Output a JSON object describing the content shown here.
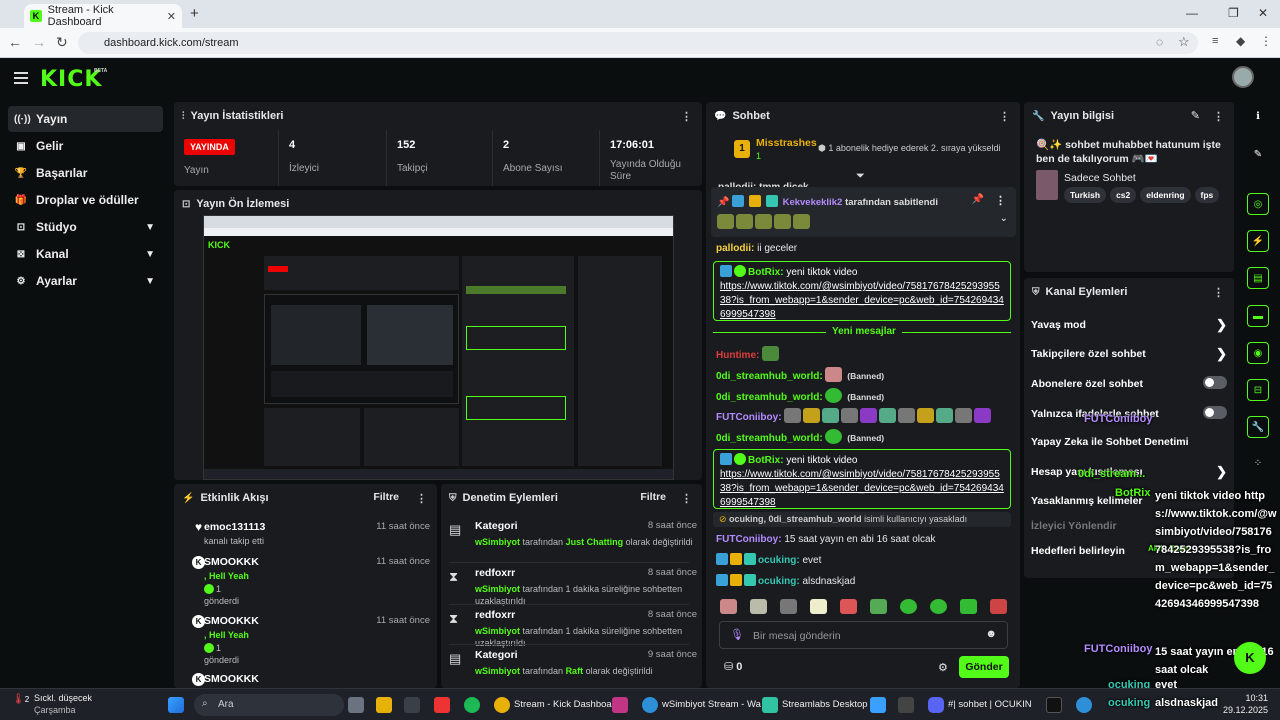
{
  "browser": {
    "tab_title": "Stream - Kick Dashboard",
    "url": "dashboard.kick.com/stream"
  },
  "header": {
    "logo": "KICK",
    "beta": "BETA"
  },
  "sidebar": {
    "items": [
      {
        "label": "Yayın",
        "icon": "broadcast-icon"
      },
      {
        "label": "Gelir",
        "icon": "money-icon"
      },
      {
        "label": "Başarılar",
        "icon": "trophy-icon"
      },
      {
        "label": "Droplar ve ödüller",
        "icon": "gift-icon"
      },
      {
        "label": "Stüdyo",
        "icon": "studio-icon"
      },
      {
        "label": "Kanal",
        "icon": "channel-icon"
      },
      {
        "label": "Ayarlar",
        "icon": "gear-icon"
      }
    ]
  },
  "stats": {
    "title": "Yayın İstatistikleri",
    "live_badge": "YAYINDA",
    "live_label": "Yayın",
    "viewers": {
      "value": "4",
      "label": "İzleyici"
    },
    "followers": {
      "value": "152",
      "label": "Takipçi"
    },
    "subs": {
      "value": "2",
      "label": "Abone Sayısı"
    },
    "uptime": {
      "value": "17:06:01",
      "label": "Yayında Olduğu Süre"
    }
  },
  "preview": {
    "title": "Yayın Ön İzlemesi"
  },
  "activity": {
    "title": "Etkinlik Akışı",
    "filter": "Filtre",
    "items": [
      {
        "name": "emoc131113",
        "time": "11 saat önce",
        "sub": "kanalı takip etti",
        "extra": "",
        "count": "",
        "sent": ""
      },
      {
        "name": "SMOOKKK",
        "time": "11 saat önce",
        "sub": ", Hell Yeah",
        "extra": "",
        "count": "1",
        "sent": "gönderdi"
      },
      {
        "name": "SMOOKKK",
        "time": "11 saat önce",
        "sub": ", Hell Yeah",
        "extra": "",
        "count": "1",
        "sent": "gönderdi"
      },
      {
        "name": "SMOOKKK",
        "time": "",
        "sub": "",
        "extra": "",
        "count": "",
        "sent": ""
      }
    ]
  },
  "moderation": {
    "title": "Denetim Eylemleri",
    "filter": "Filtre",
    "items": [
      {
        "name": "Kategori",
        "time": "8 saat önce",
        "user": "wSimbiyot",
        "mid": " tarafından ",
        "hl2": "Just Chatting",
        "end": " olarak değiştirildi"
      },
      {
        "name": "redfoxrr",
        "time": "8 saat önce",
        "user": "wSimbiyot",
        "mid": " tarafından 1 dakika süreliğine sohbetten uzaklaştırıldı",
        "hl2": "",
        "end": ""
      },
      {
        "name": "redfoxrr",
        "time": "8 saat önce",
        "user": "wSimbiyot",
        "mid": " tarafından 1 dakika süreliğine sohbetten uzaklaştırıldı",
        "hl2": "",
        "end": ""
      },
      {
        "name": "Kategori",
        "time": "9 saat önce",
        "user": "wSimbiyot",
        "mid": " tarafından ",
        "hl2": "Raft",
        "end": "  olarak değiştirildi"
      }
    ]
  },
  "chat": {
    "title": "Sohbet",
    "gifter": {
      "name": "Misstrashes",
      "count": "1",
      "text": "1 abonelik hediye ederek 2. sıraya yükseldi"
    },
    "pinned": {
      "by": "Kekvekeklik2",
      "text": "tarafından sabitlendi"
    },
    "cut_line": "pallodii: tmm dicek",
    "m1": {
      "name": "pallodii:",
      "text": " ii geceler"
    },
    "bot1": {
      "name": "BotRix:",
      "text": " yeni tiktok video",
      "link": "https://www.tiktok.com/@wsimbiyot/video/7581767842529395538?is_from_webapp=1&sender_device=pc&web_id=7542694346999547398"
    },
    "new_messages": "Yeni mesajlar",
    "m2": {
      "name": "Huntime:"
    },
    "m3": {
      "name": "0di_streamhub_world:",
      "banned": "(Banned)"
    },
    "m4": {
      "name": "0di_streamhub_world:",
      "banned": "(Banned)"
    },
    "m5": {
      "name": "FUTConiiboy:"
    },
    "m6": {
      "name": "0di_streamhub_world:",
      "banned": "(Banned)"
    },
    "bot2": {
      "name": "BotRix:",
      "text": " yeni tiktok video",
      "link": "https://www.tiktok.com/@wsimbiyot/video/7581767842529395538?is_from_webapp=1&sender_device=pc&web_id=7542694346999547398"
    },
    "ban_notice": {
      "users": "ocuking, 0di_streamhub_world",
      "text": " isimli kullanıcıyı yasakladı"
    },
    "m7": {
      "name": "FUTConiiboy:",
      "text": " 15 saat yayın en abi 16 saat olcak"
    },
    "m8": {
      "name": "ocuking:",
      "text": " evet"
    },
    "m9": {
      "name": "ocuking:",
      "text": " alsdnaskjad"
    },
    "input_placeholder": "Bir mesaj gönderin",
    "points": "0",
    "send": "Gönder"
  },
  "info": {
    "title": "Yayın bilgisi",
    "stream_title": "🍭✨ sohbet muhabbet hatunum işte ben de takılıyorum 🎮💌",
    "category": "Sadece Sohbet",
    "tags": [
      "Turkish",
      "cs2",
      "eldenring",
      "fps"
    ]
  },
  "channel_actions": {
    "title": "Kanal Eylemleri",
    "items": [
      "Yavaş mod",
      "Takipçilere özel sohbet",
      "Abonelere özel sohbet",
      "Yalnızca ifadelerle sohbet",
      "Yapay Zeka ile Sohbet Denetimi",
      "Hesap yaşı kısıtlaması",
      "Yasaklanmış kelimeler",
      "İzleyici Yönlendir",
      "Hedefleri belirleyin"
    ]
  },
  "overlay": {
    "bot_name": "BotRix",
    "bot_text": "yeni tiktok video https://www.tiktok.com/@wsimbiyot/video/7581767842529395538?is_from_webapp=1&sender_device=pc&web_id=7542694346999547398",
    "fut_name": "FUTConiiboy",
    "fut_text": "15 saat yayın en abi 16 saat olcak",
    "oc1_name": "ocuking",
    "oc1_text": "evet",
    "oc2_name": "ocuking",
    "oc2_text": "alsdnaskjad",
    "odi_name": "0di_stream...",
    "fut_name2": "FUTConiiboy",
    "akll": "Akıllı ifade"
  },
  "taskbar": {
    "weather_temp": "2",
    "weather_text": "Sıckl. düşecek",
    "weather_sub": "Çarşamba",
    "search": "Ara",
    "app1": "Stream - Kick Dashboar",
    "app2": "wSimbiyot Stream - Wa",
    "app3": "Streamlabs Desktop",
    "app4": "#| sohbet | OCUKIN",
    "time": "10:31",
    "date": "29.12.2025"
  },
  "colors": {
    "accent": "#53fc18",
    "live": "#eb0400",
    "panel": "#191b1f",
    "bg": "#0b0e0f"
  }
}
